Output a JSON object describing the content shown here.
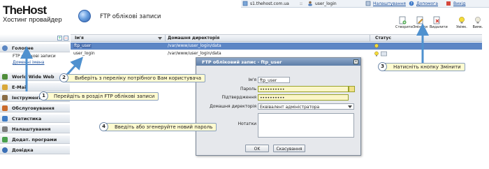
{
  "header": {
    "logo_title": "TheHost",
    "logo_subtitle": "Хостинг провайдер",
    "page_title": "FTP облікові записи"
  },
  "topbar": {
    "server": "s1.thehost.com.ua",
    "sep": "::",
    "user": "user_login",
    "settings": "Налаштування",
    "help": "Допомога",
    "logout": "Вихід"
  },
  "toolbar": {
    "create": "Створити",
    "edit": "Змінити",
    "delete": "Видалити",
    "enable": "Увімк.",
    "disable": "Вимк."
  },
  "sidebar": {
    "sections": [
      {
        "label": "Головне",
        "icon": "home-icon",
        "color": "#5b86c2"
      },
      {
        "label": "World Wide Web",
        "icon": "www-icon",
        "color": "#4f8d3a"
      },
      {
        "label": "E-Mail",
        "icon": "mail-icon",
        "color": "#d9a83a"
      },
      {
        "label": "Інструменти",
        "icon": "tools-icon",
        "color": "#8a6c45"
      },
      {
        "label": "Обслуговування",
        "icon": "service-icon",
        "color": "#c96a2c"
      },
      {
        "label": "Статистика",
        "icon": "stats-icon",
        "color": "#3e7bc4"
      },
      {
        "label": "Налаштування",
        "icon": "settings-icon",
        "color": "#7d7d7d"
      },
      {
        "label": "Додат. програми",
        "icon": "apps-icon",
        "color": "#4aa04e"
      },
      {
        "label": "Довідка",
        "icon": "help-icon",
        "color": "#3b6fb5"
      }
    ],
    "sub_items": [
      "FTP облікові записи",
      "Доменні імена"
    ]
  },
  "table": {
    "headers": [
      "Ім'я",
      "Домашня директорія",
      "Статус"
    ],
    "rows": [
      {
        "name": "ftp_user",
        "dir": "/var/www/user_login/data"
      },
      {
        "name": "user_login",
        "dir": "/var/www/user_login/data"
      }
    ]
  },
  "dialog": {
    "title": "FTP обліковий запис - ftp_user",
    "name_label": "Ім'я",
    "name_value": "ftp_user",
    "password_label": "Пароль",
    "password_value": "••••••••••",
    "confirm_label": "Підтвердження",
    "confirm_value": "••••••••••",
    "homedir_label": "Домашня директорія",
    "homedir_value": "Еквівалент адміністратора",
    "notes_label": "Нотатки",
    "ok": "OK",
    "cancel": "Скасування"
  },
  "callouts": [
    {
      "num": "1",
      "text": "Перейдіть в розділ FTP облікові записи"
    },
    {
      "num": "2",
      "text": "Виберіть з переліку потрібного Вам користувача"
    },
    {
      "num": "3",
      "text": "Натисніть кнопку Змінити"
    },
    {
      "num": "4",
      "text": "Введіть або згенеруйте новий пароль"
    }
  ],
  "colors": {
    "selected_row": "#5d86c5",
    "callout_bg": "#fffbd0",
    "arrow": "#4f91cf"
  }
}
